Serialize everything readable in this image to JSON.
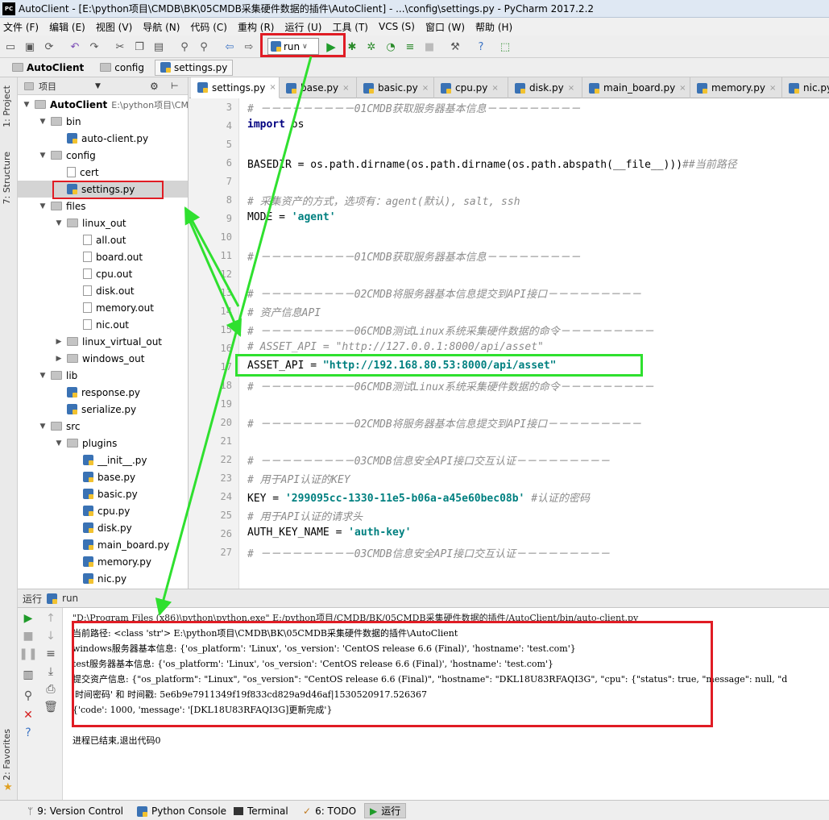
{
  "window": {
    "title": "AutoClient - [E:\\python项目\\CMDB\\BK\\05CMDB采集硬件数据的插件\\AutoClient] - ...\\config\\settings.py - PyCharm 2017.2.2"
  },
  "menu": [
    "文件 (F)",
    "编辑 (E)",
    "视图 (V)",
    "导航 (N)",
    "代码 (C)",
    "重构 (R)",
    "运行 (U)",
    "工具 (T)",
    "VCS (S)",
    "窗口 (W)",
    "帮助 (H)"
  ],
  "toolbar": {
    "run_config": "run"
  },
  "breadcrumb": [
    "AutoClient",
    "config",
    "settings.py"
  ],
  "side_tabs": {
    "project": "1: Project",
    "structure": "7: Structure",
    "favorites": "2: Favorites"
  },
  "project_panel": {
    "title": "项目"
  },
  "tree": [
    {
      "label": "AutoClient",
      "extra": "E:\\python项目\\CM",
      "icon": "folder"
    },
    {
      "label": "bin",
      "icon": "folder"
    },
    {
      "label": "auto-client.py",
      "icon": "py"
    },
    {
      "label": "config",
      "icon": "folder"
    },
    {
      "label": "cert",
      "icon": "file"
    },
    {
      "label": "settings.py",
      "icon": "py"
    },
    {
      "label": "files",
      "icon": "folder"
    },
    {
      "label": "linux_out",
      "icon": "folder"
    },
    {
      "label": "all.out",
      "icon": "file"
    },
    {
      "label": "board.out",
      "icon": "file"
    },
    {
      "label": "cpu.out",
      "icon": "file"
    },
    {
      "label": "disk.out",
      "icon": "file"
    },
    {
      "label": "memory.out",
      "icon": "file"
    },
    {
      "label": "nic.out",
      "icon": "file"
    },
    {
      "label": "linux_virtual_out",
      "icon": "folder"
    },
    {
      "label": "windows_out",
      "icon": "folder"
    },
    {
      "label": "lib",
      "icon": "folder"
    },
    {
      "label": "response.py",
      "icon": "py"
    },
    {
      "label": "serialize.py",
      "icon": "py"
    },
    {
      "label": "src",
      "icon": "folder"
    },
    {
      "label": "plugins",
      "icon": "folder"
    },
    {
      "label": "__init__.py",
      "icon": "py"
    },
    {
      "label": "base.py",
      "icon": "py"
    },
    {
      "label": "basic.py",
      "icon": "py"
    },
    {
      "label": "cpu.py",
      "icon": "py"
    },
    {
      "label": "disk.py",
      "icon": "py"
    },
    {
      "label": "main_board.py",
      "icon": "py"
    },
    {
      "label": "memory.py",
      "icon": "py"
    },
    {
      "label": "nic.py",
      "icon": "py"
    }
  ],
  "editor_tabs": [
    "settings.py",
    "base.py",
    "basic.py",
    "cpu.py",
    "disk.py",
    "main_board.py",
    "memory.py",
    "nic.py"
  ],
  "line_numbers": [
    "3",
    "4",
    "5",
    "6",
    "7",
    "8",
    "9",
    "10",
    "11",
    "12",
    "13",
    "14",
    "15",
    "16",
    "17",
    "18",
    "19",
    "20",
    "21",
    "22",
    "23",
    "24",
    "25",
    "26",
    "27"
  ],
  "code": {
    "l3": "# －－－－－－－－－01CMDB获取服务器基本信息－－－－－－－－－",
    "l4_kw": "import",
    "l4_rest": " os",
    "l6": "BASEDIR = os.path.dirname(os.path.dirname(os.path.abspath(__file__)))",
    "l6_cmt": "##当前路径",
    "l8": "# 采集资产的方式，选项有：agent(默认), salt, ssh",
    "l9": "MODE = ",
    "l9_str": "'agent'",
    "l11": "# －－－－－－－－－01CMDB获取服务器基本信息－－－－－－－－－",
    "l13": "# －－－－－－－－－02CMDB将服务器基本信息提交到API接口－－－－－－－－－",
    "l14": "# 资产信息API",
    "l15": "# －－－－－－－－－06CMDB测试Linux系统采集硬件数据的命令－－－－－－－－－",
    "l16": "# ASSET_API = \"http://127.0.0.1:8000/api/asset\"",
    "l17": "ASSET_API = ",
    "l17_str": "\"http://192.168.80.53:8000/api/asset\"",
    "l18": "# －－－－－－－－－06CMDB测试Linux系统采集硬件数据的命令－－－－－－－－－",
    "l20": "# －－－－－－－－－02CMDB将服务器基本信息提交到API接口－－－－－－－－－",
    "l22": "# －－－－－－－－－03CMDB信息安全API接口交互认证－－－－－－－－－",
    "l23": "# 用于API认证的KEY",
    "l24": "KEY = ",
    "l24_str": "'299095cc-1330-11e5-b06a-a45e60bec08b'",
    "l24_cmt": " #认证的密码",
    "l25": "# 用于API认证的请求头",
    "l26": "AUTH_KEY_NAME = ",
    "l26_str": "'auth-key'",
    "l27": "# －－－－－－－－－03CMDB信息安全API接口交互认证－－－－－－－－－"
  },
  "run_panel": {
    "label": "运行",
    "name": "run"
  },
  "console": [
    "\"D:\\Program Files (x86)\\python\\python.exe\" E:/python项目/CMDB/BK/05CMDB采集硬件数据的插件/AutoClient/bin/auto-client.py",
    "当前路径: <class 'str'> E:\\python项目\\CMDB\\BK\\05CMDB采集硬件数据的插件\\AutoClient",
    "windows服务器基本信息: {'os_platform': 'Linux', 'os_version': 'CentOS release 6.6 (Final)', 'hostname': 'test.com'}",
    "test服务器基本信息: {'os_platform': 'Linux', 'os_version': 'CentOS release 6.6 (Final)', 'hostname': 'test.com'}",
    "提交资产信息: {\"os_platform\": \"Linux\", \"os_version\": \"CentOS release 6.6 (Final)\", \"hostname\": \"DKL18U83RFAQI3G\", \"cpu\": {\"status\": true, \"message\": null, \"d",
    "'时间密码' 和 时间戳: 5e6b9e7911349f19f833cd829a9d46af|1530520917.526367",
    "{'code': 1000, 'message': '[DKL18U83RFAQI3G]更新完成'}",
    "",
    "进程已结束,退出代码0"
  ],
  "statusbar": {
    "version_control": "9: Version Control",
    "python_console": "Python Console",
    "terminal": "Terminal",
    "todo": "6: TODO",
    "run": "运行"
  }
}
